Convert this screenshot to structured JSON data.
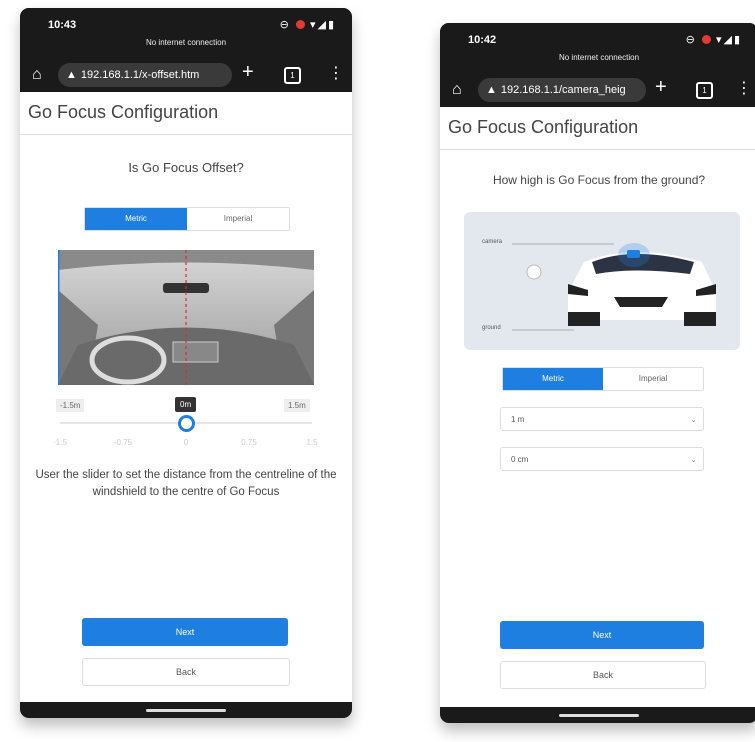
{
  "left_phone": {
    "status": {
      "time": "10:43",
      "no_internet": "No internet connection"
    },
    "browser": {
      "url": "192.168.1.1/x-offset.htm",
      "tab_count": "1"
    },
    "page_title": "Go Focus Configuration",
    "question": "Is Go Focus Offset?",
    "units": {
      "metric": "Metric",
      "imperial": "Imperial",
      "selected": "Metric"
    },
    "offset_labels": {
      "left": "-1.5m",
      "center": "0m",
      "right": "1.5m"
    },
    "slider": {
      "value_m": 0,
      "min_m": -1.5,
      "max_m": 1.5,
      "ticks": [
        "-1.5",
        "-0.75",
        "0",
        "0.75",
        "1.5"
      ]
    },
    "instructions": "User the slider to set the distance from the centreline of the windshield to the centre of Go Focus",
    "next_label": "Next",
    "back_label": "Back"
  },
  "right_phone": {
    "status": {
      "time": "10:42",
      "no_internet": "No internet connection"
    },
    "browser": {
      "url": "192.168.1.1/camera_heig",
      "tab_count": "1"
    },
    "page_title": "Go Focus Configuration",
    "question": "How high is Go Focus from the ground?",
    "diagram": {
      "camera_label": "camera",
      "ground_label": "ground"
    },
    "units": {
      "metric": "Metric",
      "imperial": "Imperial",
      "selected": "Metric"
    },
    "height_m": "1 m",
    "height_cm": "0 cm",
    "next_label": "Next",
    "back_label": "Back"
  }
}
